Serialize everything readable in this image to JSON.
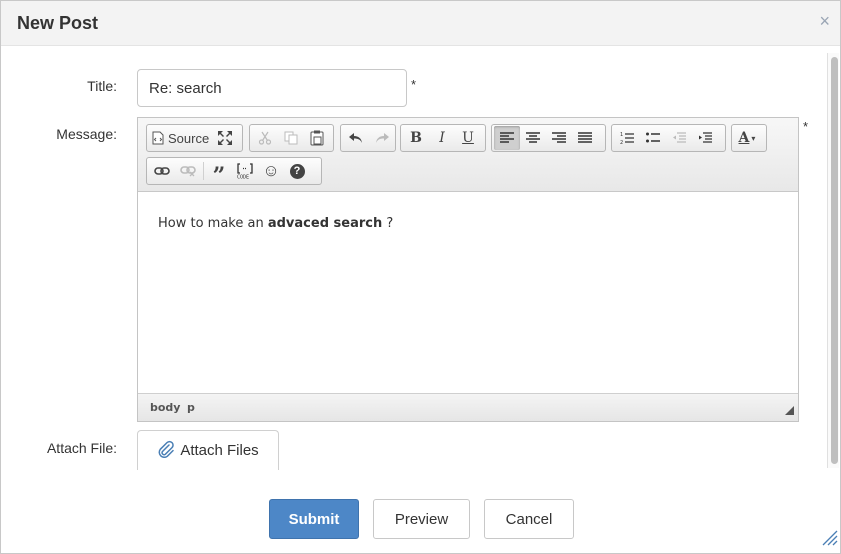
{
  "dialog": {
    "title": "New Post",
    "close_icon": "×"
  },
  "form": {
    "title_label": "Title:",
    "title_value": "Re: search",
    "message_label": "Message:",
    "required_mark": "*",
    "attach_label": "Attach File:",
    "attach_button": "Attach Files"
  },
  "toolbar": {
    "source_label": "Source",
    "icons": [
      "source-icon",
      "maximize-icon",
      "cut-icon",
      "copy-icon",
      "paste-icon",
      "undo-icon",
      "redo-icon",
      "bold-icon",
      "italic-icon",
      "underline-icon",
      "align-left-icon",
      "align-center-icon",
      "align-right-icon",
      "justify-icon",
      "numbered-list-icon",
      "bulleted-list-icon",
      "outdent-icon",
      "indent-icon",
      "text-color-icon",
      "link-icon",
      "unlink-icon",
      "blockquote-icon",
      "code-snippet-icon",
      "smiley-icon",
      "help-icon"
    ],
    "bold_glyph": "B",
    "italic_glyph": "I",
    "underline_glyph": "U",
    "text_color_glyph": "A",
    "quote_glyph": "”",
    "help_glyph": "?",
    "smiley_glyph": "☺"
  },
  "editor": {
    "content_prefix": "How to make an ",
    "content_bold": "advaced search",
    "content_suffix": " ?",
    "path": [
      "body",
      "p"
    ]
  },
  "buttons": {
    "submit": "Submit",
    "preview": "Preview",
    "cancel": "Cancel"
  },
  "colors": {
    "primary": "#4d87c7",
    "header_bg": "#f3f3f3",
    "toolbar_bg": "#e8e8e8"
  }
}
